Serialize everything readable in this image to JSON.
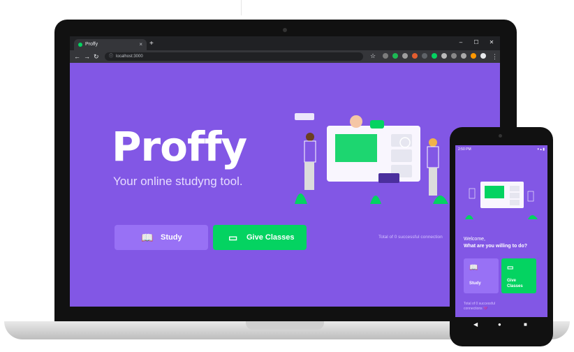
{
  "browser": {
    "tab_title": "Proffy",
    "tab_close": "×",
    "new_tab": "+",
    "window_controls": [
      "–",
      "☐",
      "✕"
    ],
    "nav": {
      "back": "←",
      "forward": "→",
      "reload": "↻"
    },
    "url": "localhost:3000"
  },
  "landing": {
    "logo": "Proffy",
    "tagline": "Your online studyng tool.",
    "study_label": "Study",
    "give_classes_label": "Give Classes",
    "total_connections": "Total of 0 successful connection"
  },
  "phone": {
    "status_time": "2:50 PM",
    "welcome": "Welcome,",
    "question": "What are you willing to do?",
    "study_label": "Study",
    "give_classes_label": "Give Classes",
    "total_connections": "Total of 0 successful connections 💜",
    "nav_back": "◀",
    "nav_home": "●",
    "nav_recent": "■"
  },
  "colors": {
    "primary": "#8257e5",
    "primary_lighter": "#9871f5",
    "secondary": "#04d361"
  },
  "icons": {
    "study": "book-open-icon",
    "give_classes": "presentation-board-icon"
  }
}
